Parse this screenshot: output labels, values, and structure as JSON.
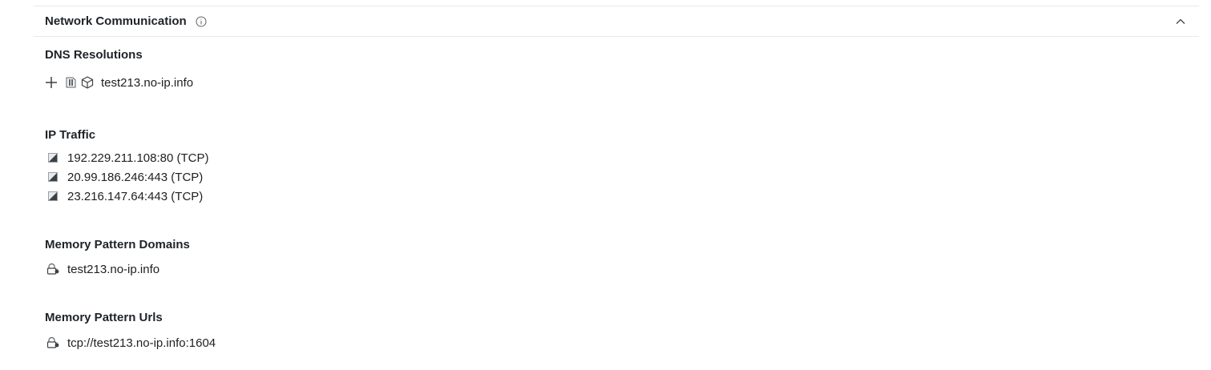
{
  "section": {
    "title": "Network Communication",
    "info_icon": "info-circle-icon",
    "collapse_icon": "chevron-up-icon"
  },
  "dns": {
    "title": "DNS Resolutions",
    "items": [
      {
        "value": "test213.no-ip.info",
        "expand_icon": "plus-icon",
        "icons": [
          "document-icon",
          "box-icon"
        ]
      }
    ]
  },
  "ip_traffic": {
    "title": "IP Traffic",
    "items": [
      {
        "value": "192.229.211.108:80 (TCP)",
        "icon": "square-icon"
      },
      {
        "value": "20.99.186.246:443 (TCP)",
        "icon": "square-icon"
      },
      {
        "value": "23.216.147.64:443 (TCP)",
        "icon": "square-icon"
      }
    ]
  },
  "memory_domains": {
    "title": "Memory Pattern Domains",
    "items": [
      {
        "value": "test213.no-ip.info",
        "icon": "memory-pattern-icon"
      }
    ]
  },
  "memory_urls": {
    "title": "Memory Pattern Urls",
    "items": [
      {
        "value": "tcp://test213.no-ip.info:1604",
        "icon": "memory-pattern-icon"
      }
    ]
  },
  "colors": {
    "divider": "#e6e8eb",
    "text": "#202124",
    "icon": "#5f6368"
  }
}
